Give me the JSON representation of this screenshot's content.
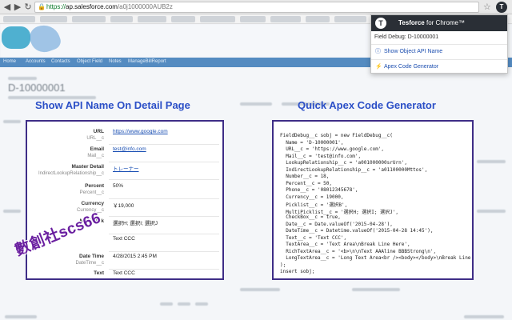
{
  "browser": {
    "url_host": "ap.salesforce.com",
    "url_path": "/a0j1000000AUB2z",
    "url_scheme": "https://",
    "icons": [
      "back-icon",
      "forward-icon",
      "reload-icon",
      "lock-icon",
      "star-icon",
      "extension-icon"
    ]
  },
  "extension": {
    "brand": "Tesforce",
    "brand_suffix": " for Chrome™",
    "subtitle": "Field Debug: D-10000001",
    "items": [
      {
        "label": "Show Object API Name",
        "icon": "info-icon"
      },
      {
        "label": "Apex Code Generator",
        "icon": "bolt-icon"
      }
    ]
  },
  "headings": {
    "left": "Show API Name On Detail Page",
    "right": "Quick Apex Code Generator"
  },
  "detail_fields": [
    {
      "label": "URL",
      "api": "URL__c",
      "value": "https://www.google.com",
      "link": true
    },
    {
      "label": "Email",
      "api": "Mail__c",
      "value": "test@info.com",
      "link": true
    },
    {
      "label": "Master Detail",
      "api": "IndirectLookupRelationship__c",
      "value": "トレーナー",
      "link": true
    },
    {
      "label": "Percent",
      "api": "Percent__c",
      "value": "50%",
      "link": false
    },
    {
      "label": "Currency",
      "api": "Currency__c",
      "value": "￥19,000",
      "link": false
    },
    {
      "label": "Multi Pick",
      "api": "",
      "value": "選択H; 選択I; 選択J",
      "link": false
    },
    {
      "label": "",
      "api": "",
      "value": "Text CCC",
      "link": false
    },
    {
      "label": "Date Time",
      "api": "DateTime__c",
      "value": "4/28/2015 2:45 PM",
      "link": false
    },
    {
      "label": "Text",
      "api": "",
      "value": "Text CCC",
      "link": false
    }
  ],
  "code_lines": [
    "FieldDebug__c sobj = new FieldDebug__c(",
    "  Name = 'D-10000001',",
    "  URL__c = 'https://www.google.com',",
    "  Mail__c = 'test@info.com',",
    "  LookupRelationship__c = 'a001000000srUrn',",
    "  IndirectLookupRelationship__c = 'a01100000Mttos',",
    "  Number__c = 18,",
    "  Percent__c = 50,",
    "  Phone__c = '08012345678',",
    "  Currency__c = 19000,",
    "  Picklist__c = '選択B',",
    "  MultiPicklist__c = '選択H; 選択I; 選択J',",
    "  CheckBox__c = true,",
    "  Date__c = Date.valueOf('2015-04-28'),",
    "  DateTime__c = Datetime.valueOf('2015-04-28 14:45'),",
    "  Text__c = 'Text CCC',",
    "  TextArea__c = 'Text Area\\nBreak Line Here',",
    "  RichTextArea__c = '<b>\\n\\nText AAAline BBBStrong\\n',",
    "  LongTextArea__c = 'Long Text Area<br /><body></body>\\nBreak Line",
    ");",
    "insert sobj;"
  ],
  "stamp": "數創社scs66",
  "sf_tabs": [
    "Home",
    "Accounts",
    "Contacts",
    "Object Field",
    "Notes",
    "ManageBillReport"
  ]
}
